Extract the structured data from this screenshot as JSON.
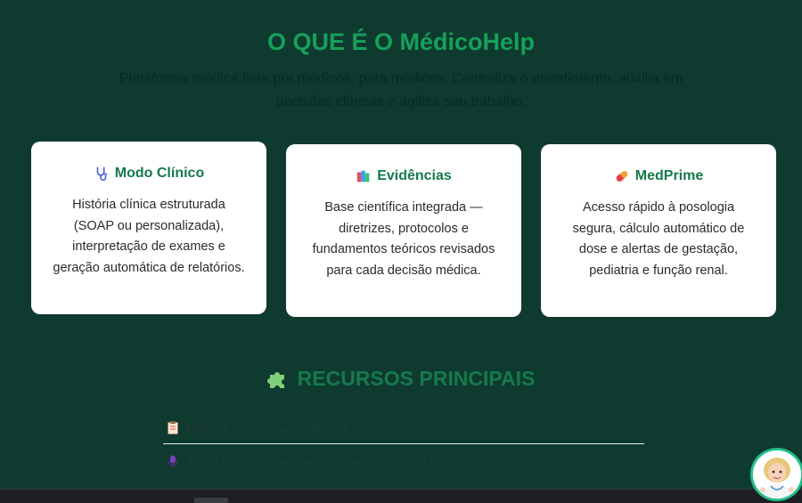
{
  "hero": {
    "title_prefix": "O QUE É O ",
    "title_brand": "MédicoHelp",
    "subtitle": "Plataforma médica feita por médicos, para médicos. Centraliza o atendimento, auxilia em decisões clínicas e agiliza seu trabalho."
  },
  "cards": [
    {
      "icon": "stethoscope-icon",
      "title": "Modo Clínico",
      "text": "História clínica estruturada (SOAP ou personalizada), interpretação de exames e geração automática de relatórios."
    },
    {
      "icon": "books-icon",
      "title": "Evidências",
      "text": "Base científica integrada — diretrizes, protocolos e fundamentos teóricos revisados para cada decisão médica."
    },
    {
      "icon": "pill-icon",
      "title": "MedPrime",
      "text": "Acesso rápido à posologia segura, cálculo automático de dose e alertas de gestação, pediatria e função renal."
    }
  ],
  "resources": {
    "icon": "puzzle-icon",
    "title": "RECURSOS PRINCIPAIS",
    "items": [
      {
        "icon": "clipboard-icon",
        "label": "História Clínica Automatizada"
      },
      {
        "icon": "microphone-icon",
        "label": "Modo Voz — converse diretamente com a Dra. Clarice"
      }
    ]
  },
  "colors": {
    "background": "#0e3a2f",
    "accent": "#17a05a",
    "card_title": "#157a4c",
    "card_bg": "#ffffff"
  },
  "assistant": {
    "icon": "doctor-avatar"
  }
}
